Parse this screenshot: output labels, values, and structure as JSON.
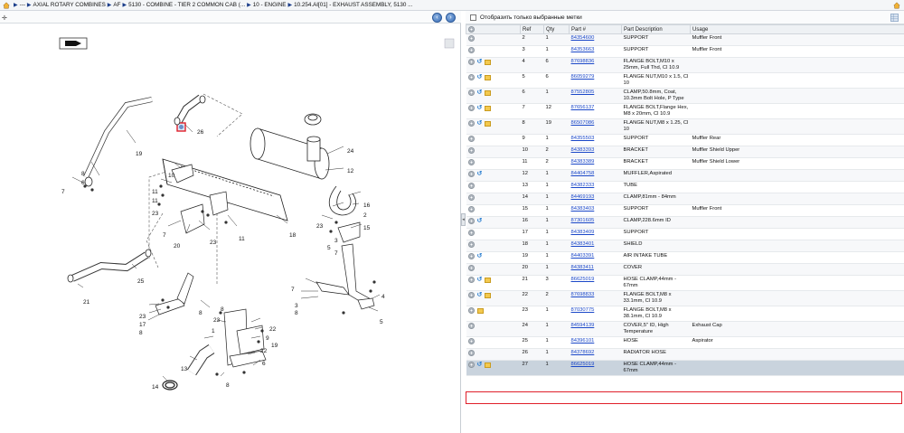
{
  "breadcrumb": {
    "items": [
      {
        "label": "---"
      },
      {
        "label": "AXIAL ROTARY COMBINES"
      },
      {
        "label": "AF"
      },
      {
        "label": "5130 - COMBINE - TIER 2 COMMON CAB (..."
      },
      {
        "label": "10 - ENGINE"
      },
      {
        "label": "10.254.AI[01] - EXHAUST ASSEMBLY, 5130 ..."
      }
    ]
  },
  "diagram": {
    "nav_back": "‹",
    "nav_forward": "›",
    "callouts": [
      "19",
      "26",
      "24",
      "12",
      "8",
      "6",
      "7",
      "10",
      "11",
      "11",
      "23",
      "16",
      "2",
      "23",
      "15",
      "7",
      "20",
      "23",
      "11",
      "18",
      "25",
      "21",
      "7",
      "3",
      "8",
      "4",
      "5",
      "23",
      "17",
      "8",
      "1",
      "22",
      "9",
      "19",
      "13",
      "8",
      "14",
      "6",
      "8",
      "3",
      "5",
      "7",
      "23",
      "8",
      "22"
    ]
  },
  "parts_panel": {
    "filter_label": "Отобразить только выбранные метки",
    "columns": {
      "ref": "Ref",
      "qty": "Qty",
      "part": "Part #",
      "desc": "Part Description",
      "usage": "Usage"
    },
    "rows": [
      {
        "icons": [
          "gear"
        ],
        "ref": "2",
        "qty": "1",
        "part": "84354600",
        "desc": "SUPPORT",
        "usage": "Muffler Front"
      },
      {
        "icons": [
          "gear"
        ],
        "ref": "3",
        "qty": "1",
        "part": "84353663",
        "desc": "SUPPORT",
        "usage": "Muffler Front"
      },
      {
        "icons": [
          "gear",
          "undo",
          "box"
        ],
        "ref": "4",
        "qty": "6",
        "part": "87698836",
        "desc": "FLANGE BOLT,M10 x 25mm, Full Thd, Cl 10.9",
        "usage": ""
      },
      {
        "icons": [
          "gear",
          "undo",
          "box"
        ],
        "ref": "5",
        "qty": "6",
        "part": "86059279",
        "desc": "FLANGE NUT,M10 x 1.5, Cl 10",
        "usage": ""
      },
      {
        "icons": [
          "gear",
          "undo",
          "box"
        ],
        "ref": "6",
        "qty": "1",
        "part": "87552805",
        "desc": "CLAMP,50.8mm, Coat, 10.3mm Bolt Hole, P Type",
        "usage": ""
      },
      {
        "icons": [
          "gear",
          "undo",
          "box"
        ],
        "ref": "7",
        "qty": "12",
        "part": "87656137",
        "desc": "FLANGE BOLT,Flange Hex, M8 x 20mm, Cl 10.9",
        "usage": ""
      },
      {
        "icons": [
          "gear",
          "undo",
          "box"
        ],
        "ref": "8",
        "qty": "19",
        "part": "86507086",
        "desc": "FLANGE NUT,M8 x 1.25, Cl 10",
        "usage": ""
      },
      {
        "icons": [
          "gear"
        ],
        "ref": "9",
        "qty": "1",
        "part": "84355503",
        "desc": "SUPPORT",
        "usage": "Muffler Rear"
      },
      {
        "icons": [
          "gear"
        ],
        "ref": "10",
        "qty": "2",
        "part": "84383393",
        "desc": "BRACKET",
        "usage": "Muffler Shield Upper"
      },
      {
        "icons": [
          "gear"
        ],
        "ref": "11",
        "qty": "2",
        "part": "84383389",
        "desc": "BRACKET",
        "usage": "Muffler Shield Lower"
      },
      {
        "icons": [
          "gear",
          "undo"
        ],
        "ref": "12",
        "qty": "1",
        "part": "84404758",
        "desc": "MUFFLER,Aspirated",
        "usage": ""
      },
      {
        "icons": [
          "gear"
        ],
        "ref": "13",
        "qty": "1",
        "part": "84382333",
        "desc": "TUBE",
        "usage": ""
      },
      {
        "icons": [
          "gear"
        ],
        "ref": "14",
        "qty": "1",
        "part": "84469193",
        "desc": "CLAMP,81mm - 84mm",
        "usage": ""
      },
      {
        "icons": [
          "gear"
        ],
        "ref": "15",
        "qty": "1",
        "part": "84383403",
        "desc": "SUPPORT",
        "usage": "Muffler Front"
      },
      {
        "icons": [
          "gear",
          "undo"
        ],
        "ref": "16",
        "qty": "1",
        "part": "87301605",
        "desc": "CLAMP,228.6mm ID",
        "usage": ""
      },
      {
        "icons": [
          "gear"
        ],
        "ref": "17",
        "qty": "1",
        "part": "84383409",
        "desc": "SUPPORT",
        "usage": ""
      },
      {
        "icons": [
          "gear"
        ],
        "ref": "18",
        "qty": "1",
        "part": "84383401",
        "desc": "SHIELD",
        "usage": ""
      },
      {
        "icons": [
          "gear",
          "undo"
        ],
        "ref": "19",
        "qty": "1",
        "part": "84403391",
        "desc": "AIR INTAKE TUBE",
        "usage": ""
      },
      {
        "icons": [
          "gear"
        ],
        "ref": "20",
        "qty": "1",
        "part": "84383411",
        "desc": "COVER",
        "usage": ""
      },
      {
        "icons": [
          "gear",
          "undo",
          "box"
        ],
        "ref": "21",
        "qty": "3",
        "part": "86625019",
        "desc": "HOSE CLAMP,44mm - 67mm",
        "usage": ""
      },
      {
        "icons": [
          "gear",
          "undo",
          "box"
        ],
        "ref": "22",
        "qty": "2",
        "part": "87698833",
        "desc": "FLANGE BOLT,M8 x 33.1mm, Cl 10.9",
        "usage": ""
      },
      {
        "icons": [
          "gear",
          "box"
        ],
        "ref": "23",
        "qty": "1",
        "part": "87030775",
        "desc": "FLANGE BOLT,M8 x 38.1mm, Cl 10.9",
        "usage": ""
      },
      {
        "icons": [
          "gear"
        ],
        "ref": "24",
        "qty": "1",
        "part": "84594139",
        "desc": "COVER,5\" ID, High Temperature",
        "usage": "Exhaust Cap"
      },
      {
        "icons": [
          "gear"
        ],
        "ref": "25",
        "qty": "1",
        "part": "84396101",
        "desc": "HOSE",
        "usage": "Aspirator"
      },
      {
        "icons": [
          "gear"
        ],
        "ref": "26",
        "qty": "1",
        "part": "84378692",
        "desc": "RADIATOR HOSE",
        "usage": ""
      },
      {
        "icons": [
          "gear",
          "undo",
          "box"
        ],
        "ref": "27",
        "qty": "1",
        "part": "86625019",
        "desc": "HOSE CLAMP,44mm - 67mm",
        "usage": "",
        "selected": true
      }
    ]
  },
  "colors": {
    "link": "#1a47c8",
    "selection_frame": "#e0202a",
    "selected_row": "#c9d3dd"
  }
}
